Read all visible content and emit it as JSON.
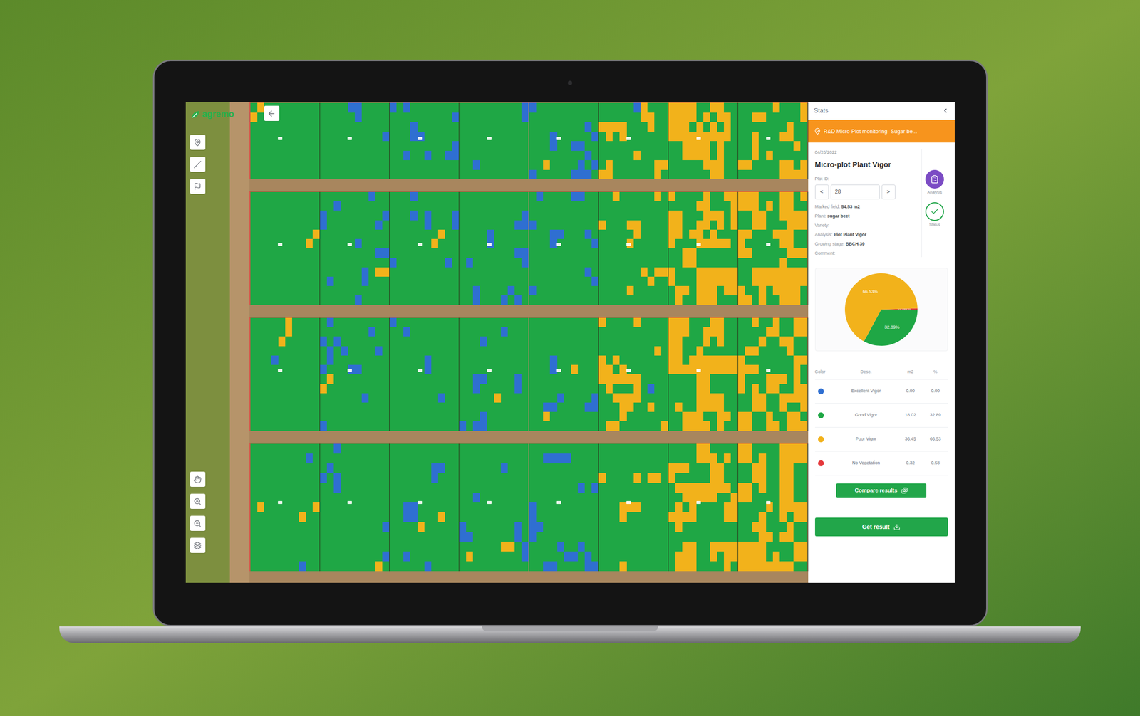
{
  "app": {
    "logo": "agremo"
  },
  "stats": {
    "header": "Stats",
    "project": "R&D Micro-Plot monitoring- Sugar be...",
    "date": "04/26/2022",
    "title": "Micro-plot Plant Vigor",
    "plot_id": {
      "label": "Plot ID:",
      "value": "28",
      "prev": "<",
      "next": ">"
    },
    "details": [
      {
        "label": "Marked field:",
        "value": "54.53 m2"
      },
      {
        "label": "Plant:",
        "value": "sugar beet"
      },
      {
        "label": "Variety:"
      },
      {
        "label": "Analysis:",
        "value": "Plot Plant Vigor"
      },
      {
        "label": "Growing stage:",
        "value": "BBCH 39"
      },
      {
        "label": "Comment:"
      }
    ],
    "actions": [
      {
        "label": "Analysis",
        "kind": "analysis"
      },
      {
        "label": "Status",
        "kind": "status"
      }
    ],
    "chart": {
      "slices": [
        {
          "label": "0.58%",
          "value": 0.58,
          "color": "#e5383b"
        },
        {
          "label": "32.89%",
          "value": 32.89,
          "color": "#1fa745"
        },
        {
          "label": "66.53%",
          "value": 66.53,
          "color": "#f2b21b"
        }
      ]
    },
    "table": {
      "columns": [
        "Color",
        "Desc.",
        "m2",
        "%"
      ],
      "rows": [
        {
          "desc": "Excellent Vigor",
          "m2": "0.00",
          "pct": "0.00",
          "color": "#2f6fd1"
        },
        {
          "desc": "Good Vigor",
          "m2": "18.02",
          "pct": "32.89",
          "color": "#1fa745"
        },
        {
          "desc": "Poor Vigor",
          "m2": "36.45",
          "pct": "66.53",
          "color": "#f2b21b"
        },
        {
          "desc": "No Vegetation",
          "m2": "0.32",
          "pct": "0.58",
          "color": "#e5383b"
        }
      ]
    },
    "buttons": [
      "Compare results",
      "Get result"
    ]
  }
}
